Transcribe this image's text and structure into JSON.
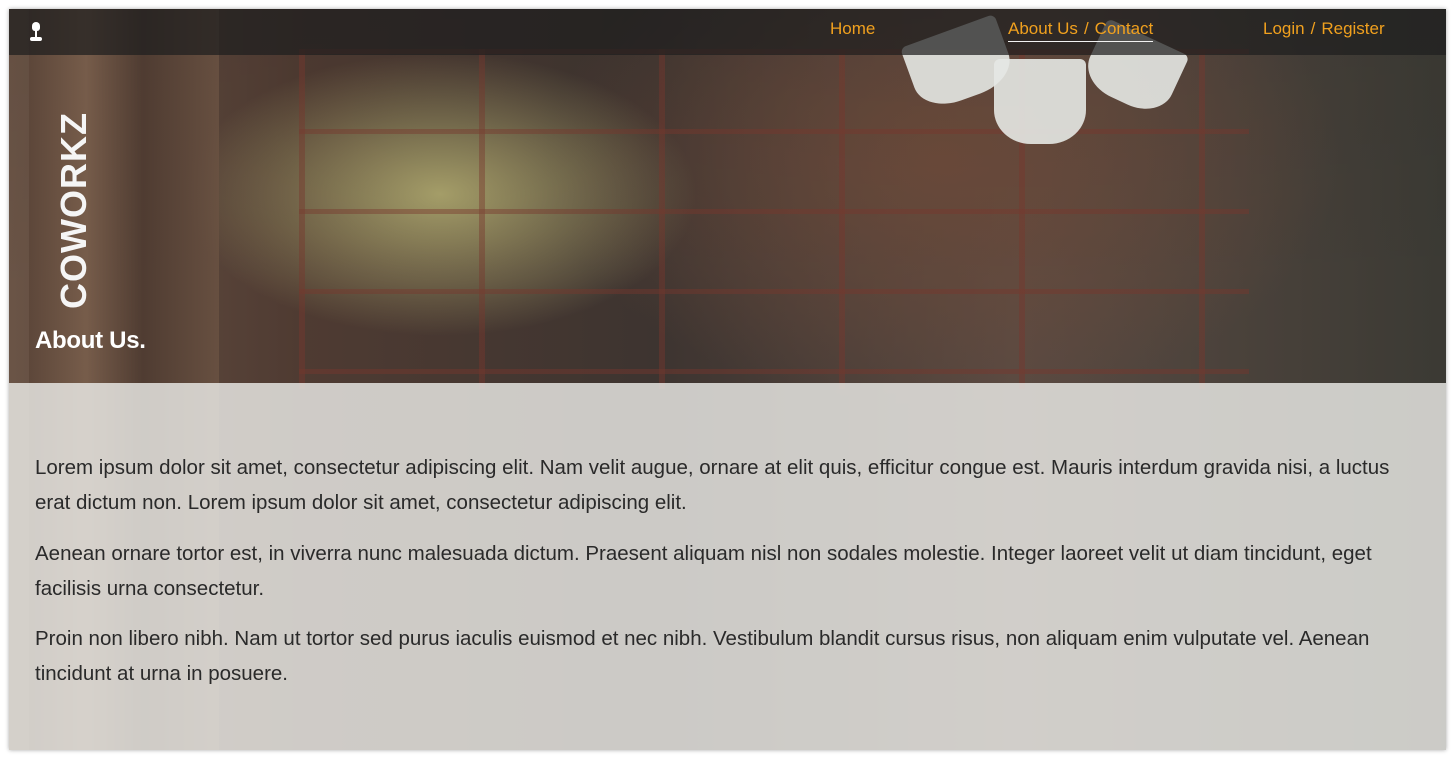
{
  "nav": {
    "home": "Home",
    "about": "About Us",
    "contact": "Contact",
    "login": "Login",
    "register": "Register",
    "separator": "/"
  },
  "brand": "COWORKZ",
  "page_title": "About Us.",
  "paragraphs": [
    "Lorem ipsum dolor sit amet, consectetur adipiscing elit. Nam velit augue, ornare at elit quis, efficitur congue est. Mauris interdum gravida nisi, a luctus erat dictum non. Lorem ipsum dolor sit amet, consectetur adipiscing elit.",
    "Aenean ornare tortor est, in viverra nunc malesuada dictum. Praesent aliquam nisl non sodales molestie. Integer laoreet velit ut diam tincidunt, eget facilisis urna consectetur.",
    "Proin non libero nibh. Nam ut tortor sed purus iaculis euismod et nec nibh. Vestibulum blandit cursus risus, non aliquam enim vulputate vel. Aenean tincidunt at urna in posuere."
  ],
  "colors": {
    "accent": "#f0a01e",
    "topbar": "#1e1e1e",
    "text": "#2a2a2a"
  },
  "icons": {
    "logo": "desk-lamp-icon"
  }
}
